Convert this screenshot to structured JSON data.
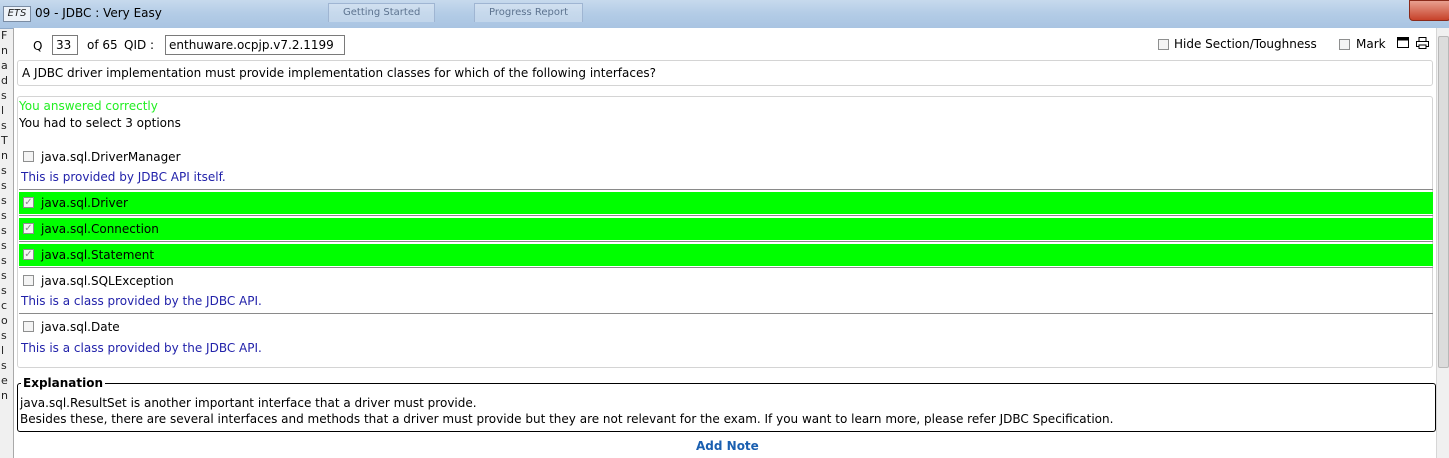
{
  "window": {
    "title": "09 - JDBC  :  Very Easy",
    "app_icon_text": "ETS",
    "background_tabs": [
      "Getting Started",
      "Progress Report"
    ]
  },
  "side_fragments": [
    "F",
    "n",
    "a",
    "d",
    "s",
    "l",
    "s",
    "T",
    "n",
    "s",
    "s",
    "s",
    "s",
    "s",
    "s",
    "s",
    "s",
    "s",
    "c",
    "o",
    "s",
    "l",
    "s",
    "e",
    "n"
  ],
  "question_header": {
    "q_label": "Q",
    "q_number": "33",
    "of_total": "of 65",
    "qid_label": "QID :",
    "qid_value": "enthuware.ocpjp.v7.2.1199",
    "hide_section_label": "Hide Section/Toughness",
    "mark_label": "Mark"
  },
  "question_text": "A JDBC driver implementation must provide implementation classes for which of the following interfaces?",
  "result": {
    "status": "You answered correctly",
    "instruction": "You had to select 3 options"
  },
  "options": [
    {
      "label": "java.sql.DriverManager",
      "checked": false,
      "correct": false,
      "note": "This is provided by JDBC API itself."
    },
    {
      "label": "java.sql.Driver",
      "checked": true,
      "correct": true,
      "note": ""
    },
    {
      "label": "java.sql.Connection",
      "checked": true,
      "correct": true,
      "note": ""
    },
    {
      "label": "java.sql.Statement",
      "checked": true,
      "correct": true,
      "note": ""
    },
    {
      "label": "java.sql.SQLException",
      "checked": false,
      "correct": false,
      "note": "This is a class provided by the JDBC API."
    },
    {
      "label": "java.sql.Date",
      "checked": false,
      "correct": false,
      "note": "This is a class provided by the JDBC API."
    }
  ],
  "explanation": {
    "legend": "Explanation",
    "lines": [
      "java.sql.ResultSet is another important interface that a driver must provide.",
      "Besides these, there are several interfaces and methods that a driver must provide but they are not relevant for the exam. If you want to learn more, please refer JDBC Specification."
    ]
  },
  "add_note_label": "Add Note",
  "colors": {
    "correct_highlight": "#00ff00",
    "status_green": "#22ee22",
    "note_blue": "#2222aa",
    "link_blue": "#1a5fb0"
  }
}
